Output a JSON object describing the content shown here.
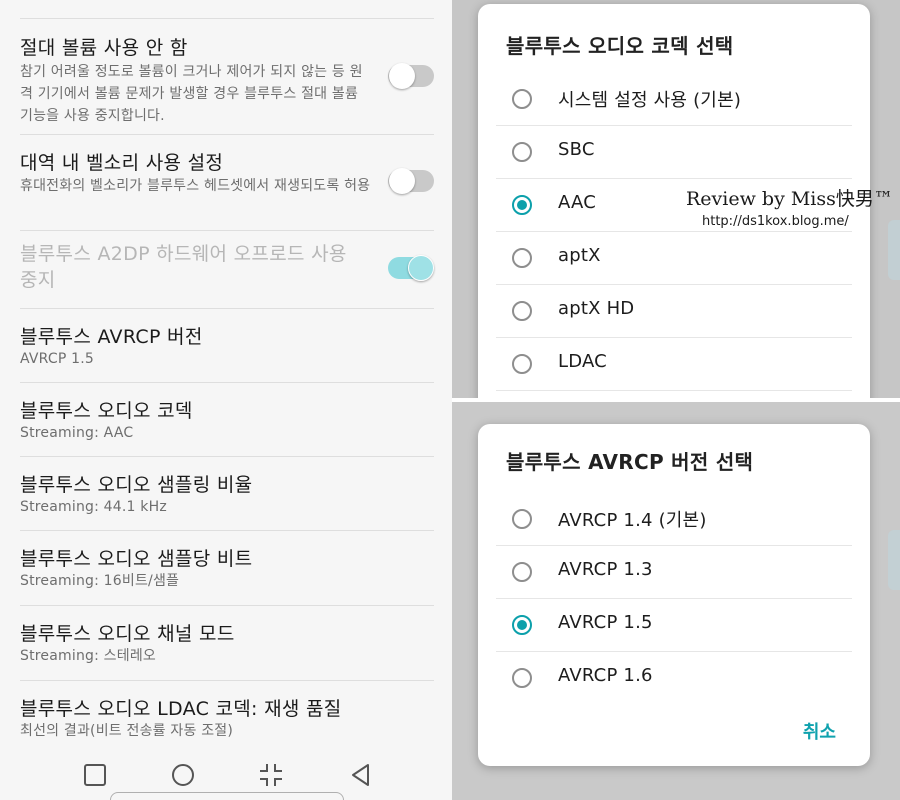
{
  "settings_list": {
    "items": [
      {
        "title": "절대 볼륨 사용 안 함",
        "description": "참기 어려울 정도로 볼륨이 크거나 제어가 되지 않는 등 원격 기기에서 볼륨 문제가 발생할 경우 블루투스 절대 볼륨 기능을 사용 중지합니다.",
        "toggle_on": false,
        "disabled": false
      },
      {
        "title": "대역 내 벨소리 사용 설정",
        "description": "휴대전화의 벨소리가 블루투스 헤드셋에서 재생되도록 허용",
        "toggle_on": false,
        "disabled": false
      },
      {
        "title": "블루투스 A2DP 하드웨어 오프로드 사용 중지",
        "description": "",
        "toggle_on": true,
        "disabled": true
      },
      {
        "title": "블루투스 AVRCP 버전",
        "description": "AVRCP 1.5"
      },
      {
        "title": "블루투스 오디오 코덱",
        "description": "Streaming: AAC"
      },
      {
        "title": "블루투스 오디오 샘플링 비율",
        "description": "Streaming: 44.1 kHz"
      },
      {
        "title": "블루투스 오디오 샘플당 비트",
        "description": "Streaming: 16비트/샘플"
      },
      {
        "title": "블루투스 오디오 채널 모드",
        "description": "Streaming: 스테레오"
      },
      {
        "title": "블루투스 오디오 LDAC 코덱: 재생 품질",
        "description": "최선의 결과(비트 전송률 자동 조절)"
      }
    ]
  },
  "nav_bar": {
    "icons": [
      "recent-apps-icon",
      "home-icon",
      "shrink-screen-icon",
      "back-icon"
    ]
  },
  "codec_dialog": {
    "title": "블루투스 오디오 코덱 선택",
    "options": [
      "시스템 설정 사용 (기본)",
      "SBC",
      "AAC",
      "aptX",
      "aptX HD",
      "LDAC"
    ],
    "selected": "AAC"
  },
  "watermark": {
    "line1": "Review by Miss快男™",
    "line2": "http://ds1kox.blog.me/"
  },
  "avrcp_dialog": {
    "title": "블루투스 AVRCP 버전 선택",
    "options": [
      "AVRCP 1.4 (기본)",
      "AVRCP 1.3",
      "AVRCP 1.5",
      "AVRCP 1.6"
    ],
    "selected": "AVRCP 1.5",
    "cancel_label": "취소"
  },
  "colors": {
    "accent": "#0ca0ab",
    "toggle_on": "#8fdbe1",
    "toggle_off": "#c9c9c9"
  }
}
